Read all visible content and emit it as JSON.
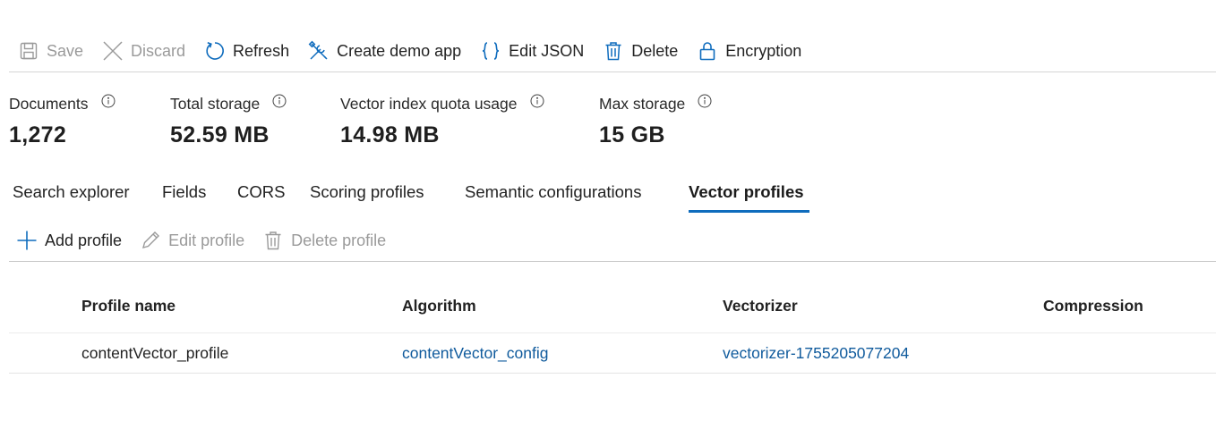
{
  "toolbar": {
    "save": "Save",
    "discard": "Discard",
    "refresh": "Refresh",
    "create_demo_app": "Create demo app",
    "edit_json": "Edit JSON",
    "delete": "Delete",
    "encryption": "Encryption"
  },
  "stats": {
    "documents": {
      "label": "Documents",
      "value": "1,272"
    },
    "total_storage": {
      "label": "Total storage",
      "value": "52.59 MB"
    },
    "vector_quota": {
      "label": "Vector index quota usage",
      "value": "14.98 MB"
    },
    "max_storage": {
      "label": "Max storage",
      "value": "15 GB"
    }
  },
  "tabs": {
    "search_explorer": "Search explorer",
    "fields": "Fields",
    "cors": "CORS",
    "scoring_profiles": "Scoring profiles",
    "semantic_configurations": "Semantic configurations",
    "vector_profiles": "Vector profiles",
    "active": "vector_profiles"
  },
  "subtoolbar": {
    "add_profile": "Add profile",
    "edit_profile": "Edit profile",
    "delete_profile": "Delete profile"
  },
  "table": {
    "headers": {
      "profile_name": "Profile name",
      "algorithm": "Algorithm",
      "vectorizer": "Vectorizer",
      "compression": "Compression"
    },
    "rows": [
      {
        "profile_name": "contentVector_profile",
        "algorithm": "contentVector_config",
        "vectorizer": "vectorizer-1755205077204",
        "compression": ""
      }
    ]
  },
  "colors": {
    "accent": "#0f6cbd",
    "link": "#0f5a9c",
    "disabled": "#9a9a9a"
  }
}
